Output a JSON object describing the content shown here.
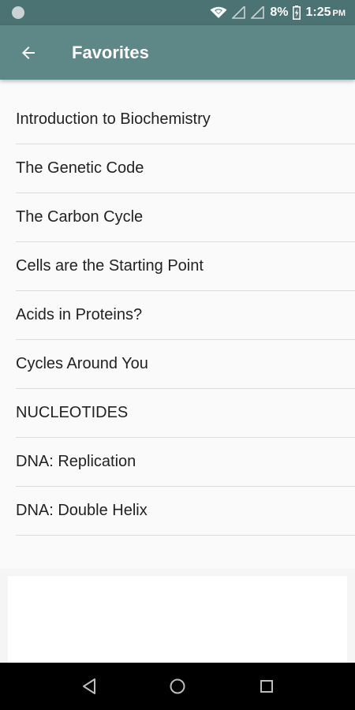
{
  "status_bar": {
    "battery": "8%",
    "time": "1:25",
    "ampm": "PM",
    "icons": [
      "notification-dot-icon",
      "wifi-icon",
      "signal-icon",
      "battery-charging-icon"
    ]
  },
  "app_bar": {
    "back_icon": "arrow-left-icon",
    "title": "Favorites",
    "color": "#5e8787"
  },
  "favorites": [
    "Introduction to Biochemistry",
    "The Genetic Code",
    "The Carbon Cycle",
    "Cells are the Starting Point",
    "Acids in Proteins?",
    "Cycles Around You",
    "NUCLEOTIDES",
    "DNA: Replication",
    "DNA: Double Helix"
  ],
  "nav_bar": {
    "icons": [
      "nav-back-icon",
      "nav-home-icon",
      "nav-recents-icon"
    ]
  }
}
